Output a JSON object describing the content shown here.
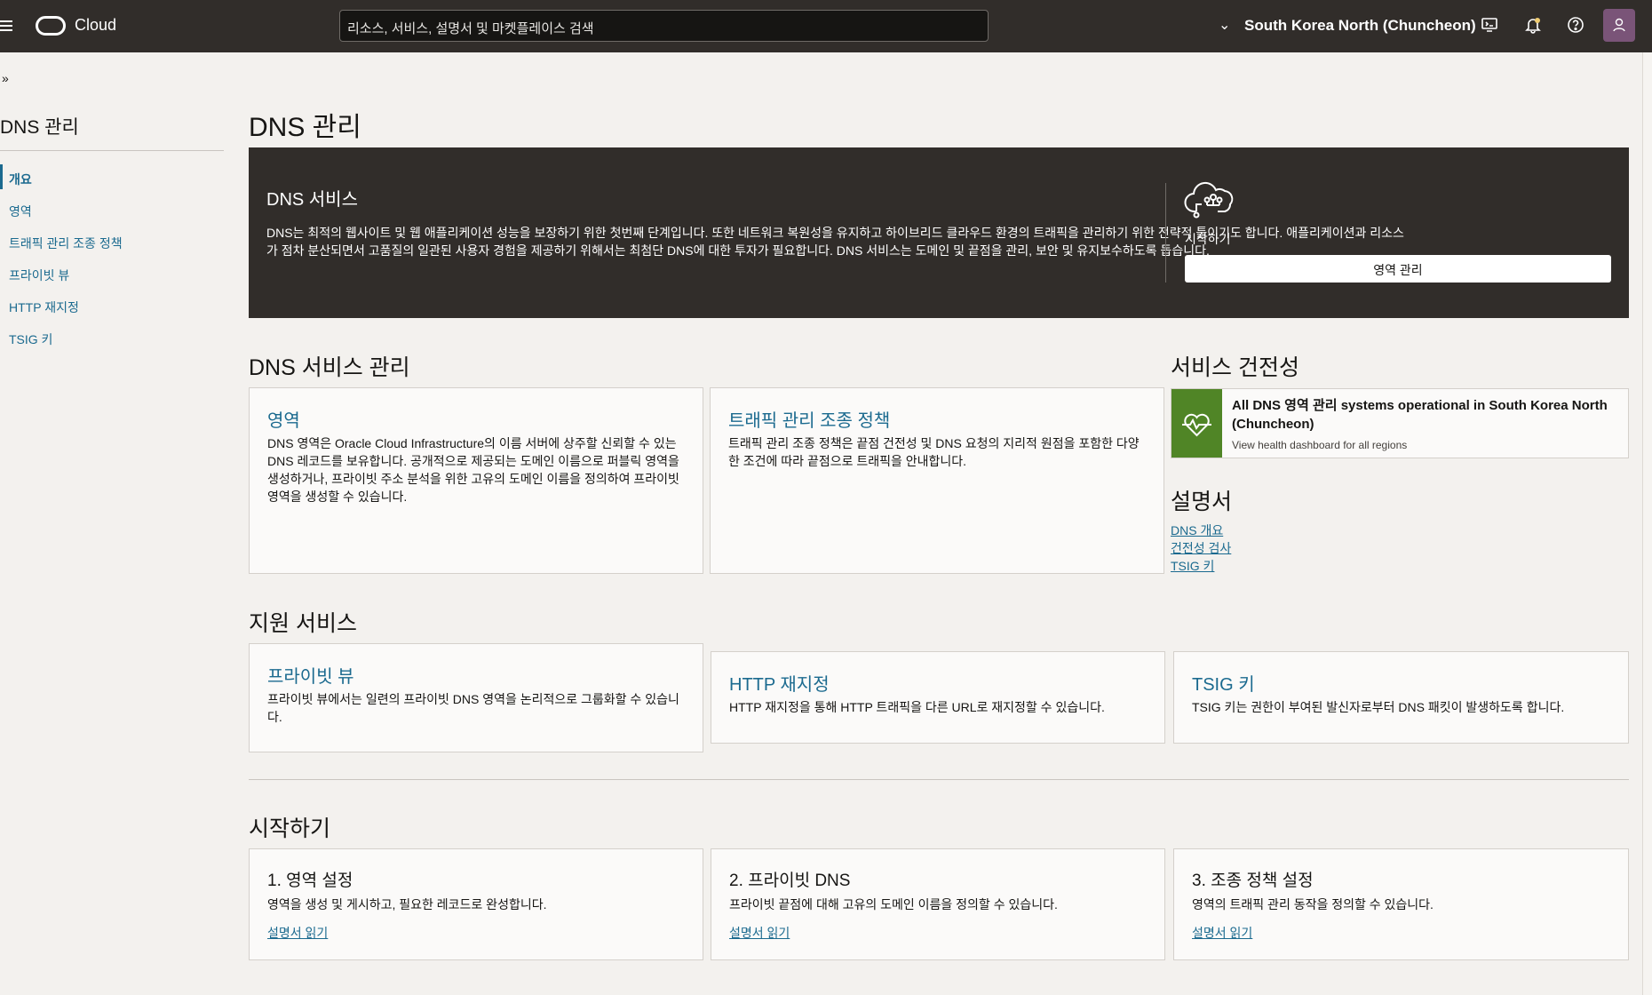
{
  "topbar": {
    "brand": "Cloud",
    "search_placeholder": "리소스, 서비스, 설명서 및 마켓플레이스 검색",
    "region": "South Korea North (Chuncheon)"
  },
  "sidebar": {
    "title": "DNS 관리",
    "items": [
      {
        "label": "개요"
      },
      {
        "label": "영역"
      },
      {
        "label": "트래픽 관리 조종 정책"
      },
      {
        "label": "프라이빗 뷰"
      },
      {
        "label": "HTTP 재지정"
      },
      {
        "label": "TSIG 키"
      }
    ]
  },
  "page": {
    "title": "DNS 관리"
  },
  "hero": {
    "title": "DNS 서비스",
    "description": "DNS는 최적의 웹사이트 및 웹 애플리케이션 성능을 보장하기 위한 첫번째 단계입니다. 또한 네트워크 복원성을 유지하고 하이브리드 클라우드 환경의 트래픽을 관리하기 위한 전략적 툴이기도 합니다. 애플리케이션과 리소스가 점차 분산되면서 고품질의 일관된 사용자 경험을 제공하기 위해서는 최첨단 DNS에 대한 투자가 필요합니다. DNS 서비스는 도메인 및 끝점을 관리, 보안 및 유지보수하도록 돕습니다.",
    "start_label": "시작하기",
    "button_label": "영역 관리"
  },
  "manage": {
    "title": "DNS 서비스 관리",
    "cards": [
      {
        "title": "영역",
        "desc": "DNS 영역은 Oracle Cloud Infrastructure의 이름 서버에 상주할 신뢰할 수 있는 DNS 레코드를 보유합니다. 공개적으로 제공되는 도메인 이름으로 퍼블릭 영역을 생성하거나, 프라이빗 주소 분석을 위한 고유의 도메인 이름을 정의하여 프라이빗 영역을 생성할 수 있습니다."
      },
      {
        "title": "트래픽 관리 조종 정책",
        "desc": "트래픽 관리 조종 정책은 끝점 건전성 및 DNS 요청의 지리적 원점을 포함한 다양한 조건에 따라 끝점으로 트래픽을 안내합니다."
      }
    ]
  },
  "health": {
    "title": "서비스 건전성",
    "status": "All DNS 영역 관리 systems operational in South Korea North (Chuncheon)",
    "link": "View health dashboard for all regions"
  },
  "docs": {
    "title": "설명서",
    "links": [
      "DNS 개요",
      "건전성 검사",
      "TSIG 키"
    ]
  },
  "support": {
    "title": "지원 서비스",
    "cards": [
      {
        "title": "프라이빗 뷰",
        "desc": "프라이빗 뷰에서는 일련의 프라이빗 DNS 영역을 논리적으로 그룹화할 수 있습니다."
      },
      {
        "title": "HTTP 재지정",
        "desc": "HTTP 재지정을 통해 HTTP 트래픽을 다른 URL로 재지정할 수 있습니다."
      },
      {
        "title": "TSIG 키",
        "desc": "TSIG 키는 권한이 부여된 발신자로부터 DNS 패킷이 발생하도록 합니다."
      }
    ]
  },
  "getting_started": {
    "title": "시작하기",
    "cards": [
      {
        "title": "1. 영역 설정",
        "desc": "영역을 생성 및 게시하고, 필요한 레코드로 완성합니다.",
        "link": "설명서 읽기"
      },
      {
        "title": "2. 프라이빗 DNS",
        "desc": "프라이빗 끝점에 대해 고유의 도메인 이름을 정의할 수 있습니다.",
        "link": "설명서 읽기"
      },
      {
        "title": "3. 조종 정책 설정",
        "desc": "영역의 트래픽 관리 동작을 정의할 수 있습니다.",
        "link": "설명서 읽기"
      }
    ]
  }
}
